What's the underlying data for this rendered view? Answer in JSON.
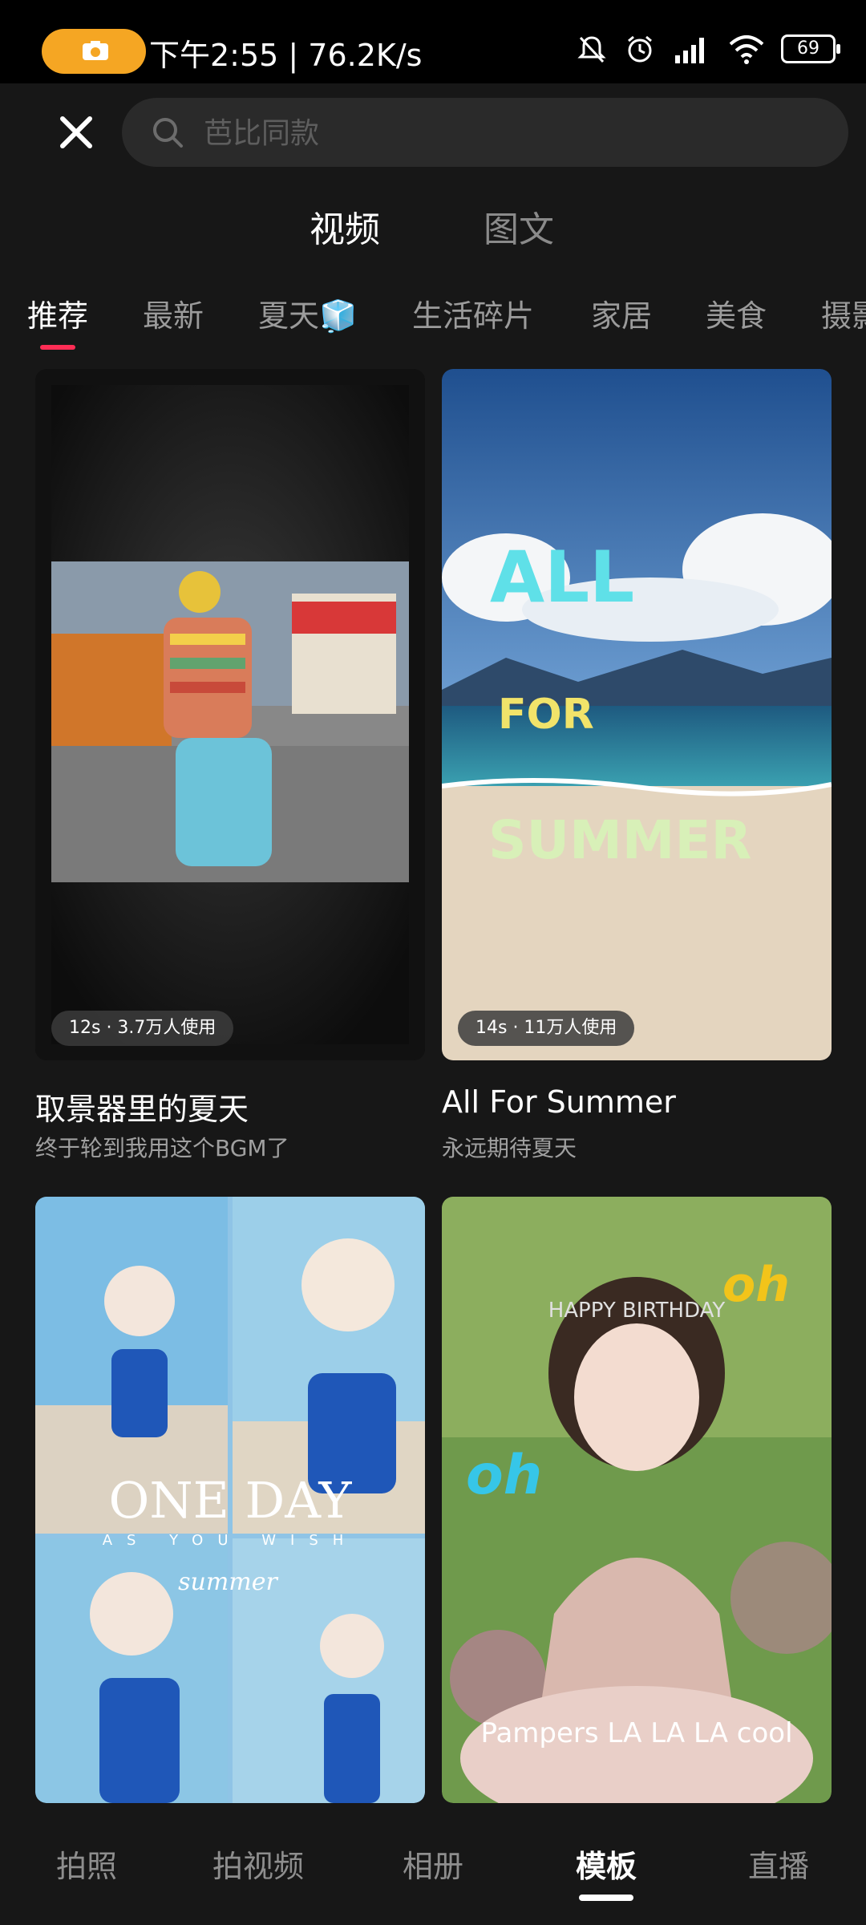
{
  "status_bar": {
    "time": "下午2:55 | 76.2K/s",
    "battery": "69",
    "accent": "#f5a623"
  },
  "search": {
    "placeholder": "芭比同款"
  },
  "main_tabs": [
    {
      "label": "视频",
      "active": true
    },
    {
      "label": "图文",
      "active": false
    }
  ],
  "categories": [
    {
      "label": "推荐",
      "active": true
    },
    {
      "label": "最新"
    },
    {
      "label": "夏天🧊"
    },
    {
      "label": "生活碎片"
    },
    {
      "label": "家居"
    },
    {
      "label": "美食"
    },
    {
      "label": "摄影"
    }
  ],
  "cards": [
    {
      "usage": "12s · 3.7万人使用",
      "title": "取景器里的夏天",
      "subtitle": "终于轮到我用这个BGM了"
    },
    {
      "usage": "14s · 11万人使用",
      "title": "All For Summer",
      "subtitle": "永远期待夏天",
      "overlay_lines": [
        "ALL",
        "FOR",
        "SUMMER"
      ]
    },
    {
      "overlay_title": "ONE DAY",
      "overlay_sub": "AS YOU WISH",
      "overlay_script": "summer"
    },
    {
      "overlay_oh_1": "oh",
      "overlay_oh_2": "oh",
      "overlay_crown": "HAPPY BIRTHDAY",
      "overlay_caption": "Pampers LA LA LA cool"
    }
  ],
  "bottom_nav": [
    {
      "label": "拍照"
    },
    {
      "label": "拍视频"
    },
    {
      "label": "相册"
    },
    {
      "label": "模板",
      "active": true
    },
    {
      "label": "直播"
    }
  ],
  "colors": {
    "background": "#171717",
    "tab_indicator": "#ff2d55"
  }
}
